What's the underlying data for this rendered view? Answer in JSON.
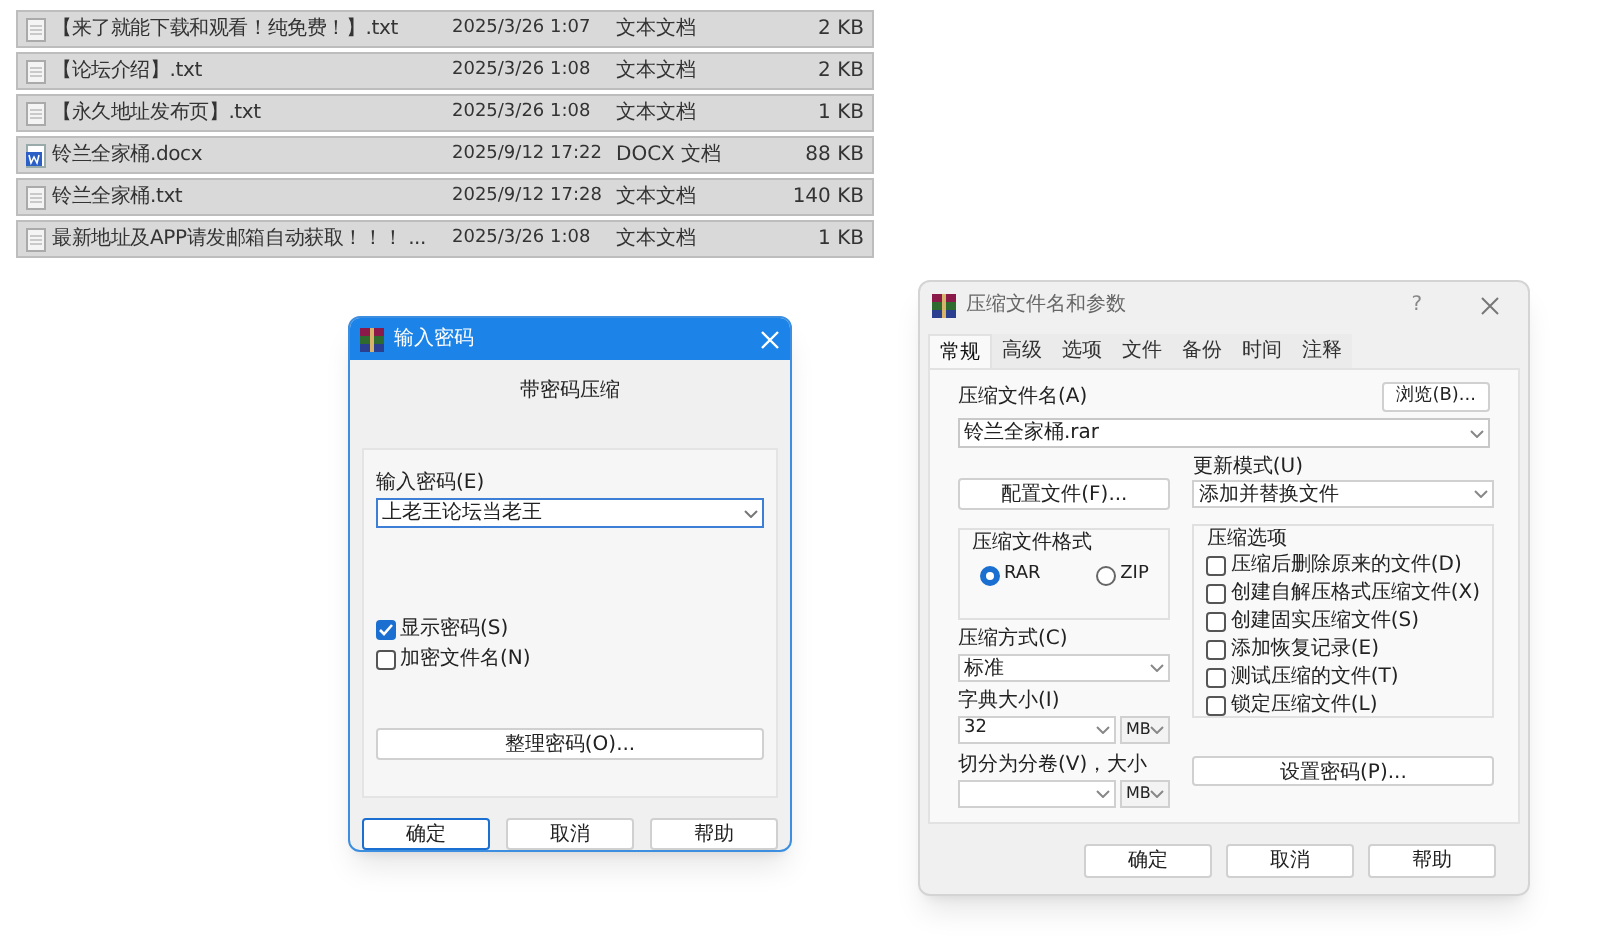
{
  "files": [
    {
      "kind": "text",
      "name": "【来了就能下载和观看！纯免费！】.txt",
      "date": "2025/3/26 1:07",
      "type": "文本文档",
      "size": "2 KB"
    },
    {
      "kind": "text",
      "name": "【论坛介绍】.txt",
      "date": "2025/3/26 1:08",
      "type": "文本文档",
      "size": "2 KB"
    },
    {
      "kind": "text",
      "name": "【永久地址发布页】.txt",
      "date": "2025/3/26 1:08",
      "type": "文本文档",
      "size": "1 KB"
    },
    {
      "kind": "word",
      "name": "铃兰全家桶.docx",
      "date": "2025/9/12 17:22",
      "type": "DOCX 文档",
      "size": "88 KB"
    },
    {
      "kind": "text",
      "name": "铃兰全家桶.txt",
      "date": "2025/9/12 17:28",
      "type": "文本文档",
      "size": "140 KB"
    },
    {
      "kind": "text",
      "name": "最新地址及APP请发邮箱自动获取！！！ ...",
      "date": "2025/3/26 1:08",
      "type": "文本文档",
      "size": "1 KB"
    }
  ],
  "password_dialog": {
    "title": "输入密码",
    "heading": "带密码压缩",
    "field_label": "输入密码(E)",
    "password": "上老王论坛当老王",
    "checkboxes": [
      {
        "label": "显示密码(S)",
        "checked": true
      },
      {
        "label": "加密文件名(N)",
        "checked": false
      }
    ],
    "organize_button": "整理密码(O)...",
    "buttons": [
      {
        "label": "确定",
        "default": true
      },
      {
        "label": "取消",
        "default": false
      },
      {
        "label": "帮助",
        "default": false
      }
    ]
  },
  "archive_dialog": {
    "title": "压缩文件名和参数",
    "help_button": "?",
    "tabs": [
      {
        "label": "常规",
        "selected": true
      },
      {
        "label": "高级",
        "selected": false
      },
      {
        "label": "选项",
        "selected": false
      },
      {
        "label": "文件",
        "selected": false
      },
      {
        "label": "备份",
        "selected": false
      },
      {
        "label": "时间",
        "selected": false
      },
      {
        "label": "注释",
        "selected": false
      }
    ],
    "archive_name_label": "压缩文件名(A)",
    "browse_button": "浏览(B)...",
    "archive_name": "铃兰全家桶.rar",
    "profiles_button": "配置文件(F)...",
    "update_mode_label": "更新模式(U)",
    "update_mode": "添加并替换文件",
    "format_label": "压缩文件格式",
    "formats": [
      {
        "label": "RAR",
        "selected": true
      },
      {
        "label": "ZIP",
        "selected": false
      }
    ],
    "method_label": "压缩方式(C)",
    "method": "标准",
    "dict_label": "字典大小(I)",
    "dict_size": "32",
    "dict_unit": "MB",
    "split_label": "切分为分卷(V)，大小",
    "split_unit": "MB",
    "options_label": "压缩选项",
    "options": [
      {
        "label": "压缩后删除原来的文件(D)",
        "checked": false
      },
      {
        "label": "创建自解压格式压缩文件(X)",
        "checked": false
      },
      {
        "label": "创建固实压缩文件(S)",
        "checked": false
      },
      {
        "label": "添加恢复记录(E)",
        "checked": false
      },
      {
        "label": "测试压缩的文件(T)",
        "checked": false
      },
      {
        "label": "锁定压缩文件(L)",
        "checked": false
      }
    ],
    "password_button": "设置密码(P)...",
    "buttons": [
      "确定",
      "取消",
      "帮助"
    ]
  }
}
